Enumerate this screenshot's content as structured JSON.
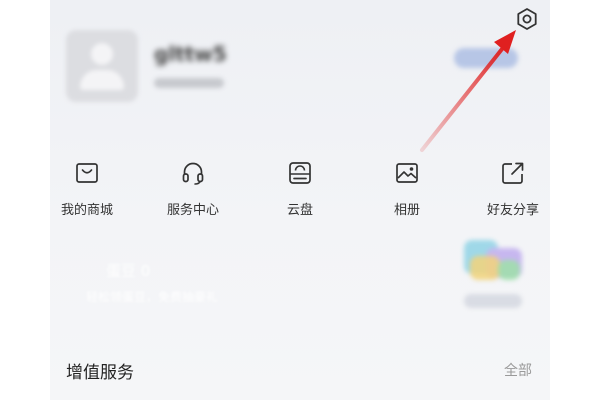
{
  "profile": {
    "username": "glttw5"
  },
  "shortcuts": [
    {
      "label": "我的商城",
      "icon": "mall-bag-icon"
    },
    {
      "label": "服务中心",
      "icon": "headset-icon"
    },
    {
      "label": "云盘",
      "icon": "cloud-drive-icon"
    },
    {
      "label": "相册",
      "icon": "photo-album-icon"
    },
    {
      "label": "好友分享",
      "icon": "share-icon"
    }
  ],
  "beans": {
    "title": "蛋豆 0",
    "subtitle": "轻松领蛋豆，免费抽豪礼"
  },
  "services": {
    "title": "增值服务",
    "more": "全部"
  },
  "annotation": {
    "arrow_color": "#e02020",
    "target_icon": "settings-gear-icon"
  },
  "colors": {
    "background": "#f3f4f7",
    "text_primary": "#333333",
    "text_muted": "#9a9a9a"
  }
}
